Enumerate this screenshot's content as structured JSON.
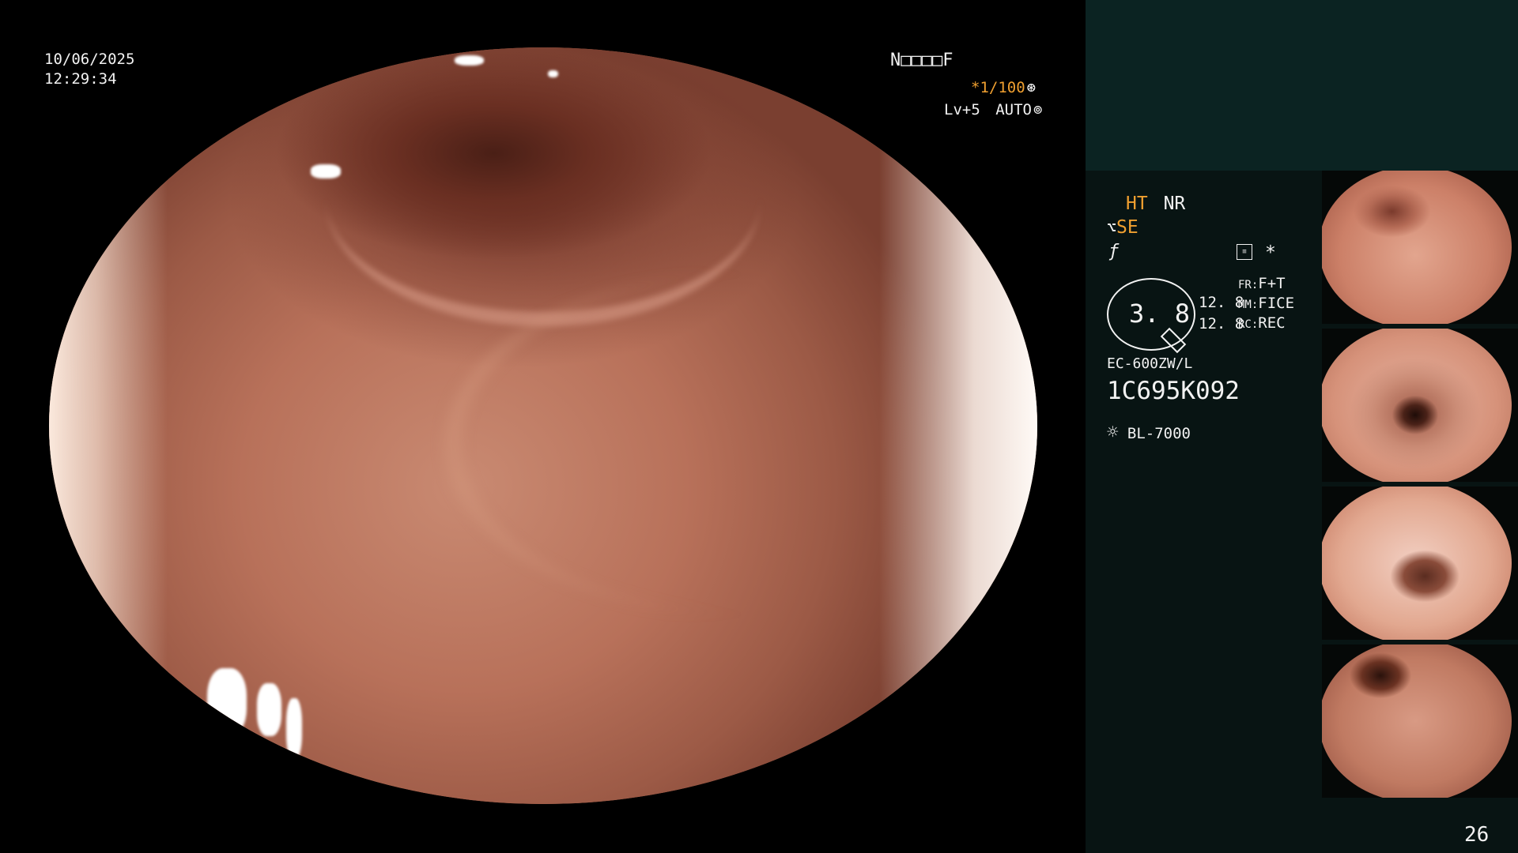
{
  "overlay": {
    "date": "10/06/2025",
    "time": "12:29:34",
    "patient_code": "N□□□□F",
    "shutter": "*1/100",
    "level": "Lv+5",
    "mode": "AUTO"
  },
  "panel": {
    "ht": "HT",
    "nr": "NR",
    "se": "SE",
    "star": "*",
    "zoom_value": "3. 8",
    "val1": "12. 8",
    "val2": "12. 8",
    "fr_label": "FR:",
    "fr_value": "F+T",
    "mm_label": "MM:",
    "mm_value": "FICE",
    "rc_label": "RC:",
    "rc_value": "REC",
    "scope_model": "EC-600ZW/L",
    "scope_serial": "1C695K092",
    "light_source": "BL-7000",
    "image_count": "26"
  },
  "icons": {
    "shutter_icon": "aperture-icon",
    "auto_icon": "iris-icon",
    "se_icon": "filter-icon",
    "f_icon": "function-icon",
    "memo_icon": "memo-icon",
    "light_icon": "light-icon"
  },
  "colors": {
    "accent": "#f0a030",
    "panel_bg": "#081413",
    "panel_top": "#0b2322"
  }
}
